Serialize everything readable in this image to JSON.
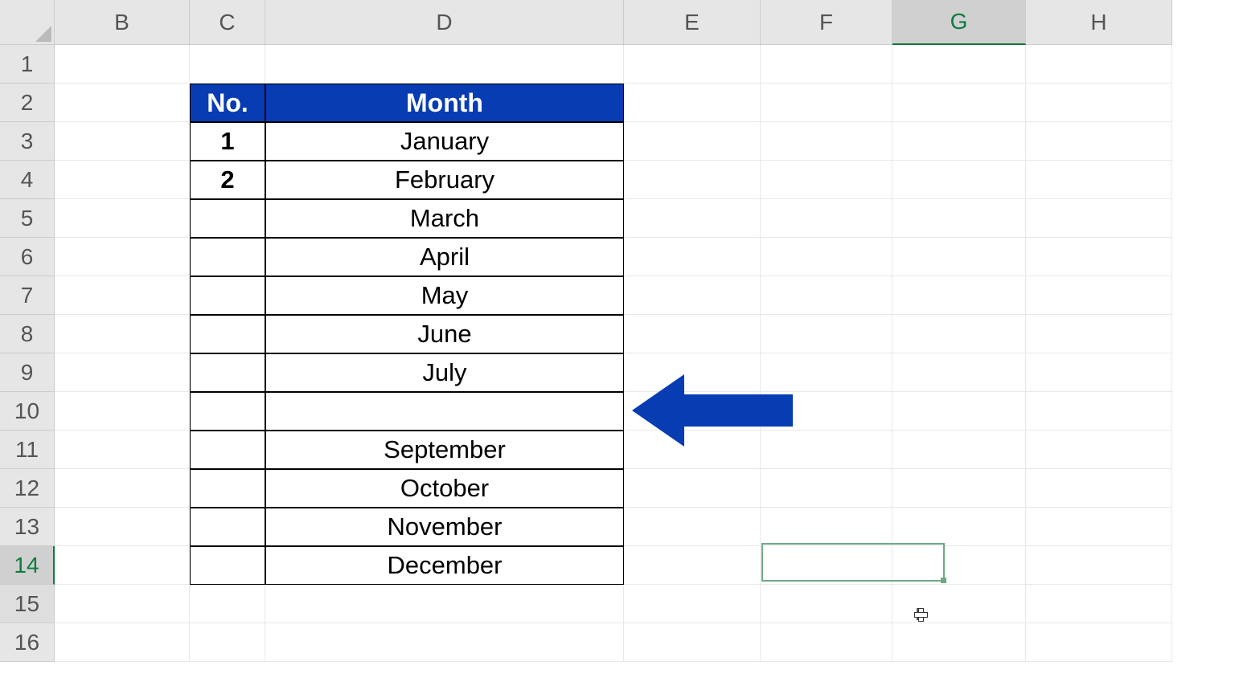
{
  "columns": [
    "B",
    "C",
    "D",
    "E",
    "F",
    "G",
    "H"
  ],
  "rows": [
    1,
    2,
    3,
    4,
    5,
    6,
    7,
    8,
    9,
    10,
    11,
    12,
    13,
    14,
    15,
    16
  ],
  "active_col": "G",
  "active_row": 14,
  "adjacent_row": 15,
  "table": {
    "header": {
      "no_label": "No.",
      "month_label": "Month"
    },
    "rows": [
      {
        "no": "1",
        "month": "January"
      },
      {
        "no": "2",
        "month": "February"
      },
      {
        "no": "",
        "month": "March"
      },
      {
        "no": "",
        "month": "April"
      },
      {
        "no": "",
        "month": "May"
      },
      {
        "no": "",
        "month": "June"
      },
      {
        "no": "",
        "month": "July"
      },
      {
        "no": "",
        "month": ""
      },
      {
        "no": "",
        "month": "September"
      },
      {
        "no": "",
        "month": "October"
      },
      {
        "no": "",
        "month": "November"
      },
      {
        "no": "",
        "month": "December"
      }
    ]
  },
  "colors": {
    "table_header_bg": "#073cb3",
    "arrow": "#073cb3",
    "selection": "#0f7b3f"
  }
}
